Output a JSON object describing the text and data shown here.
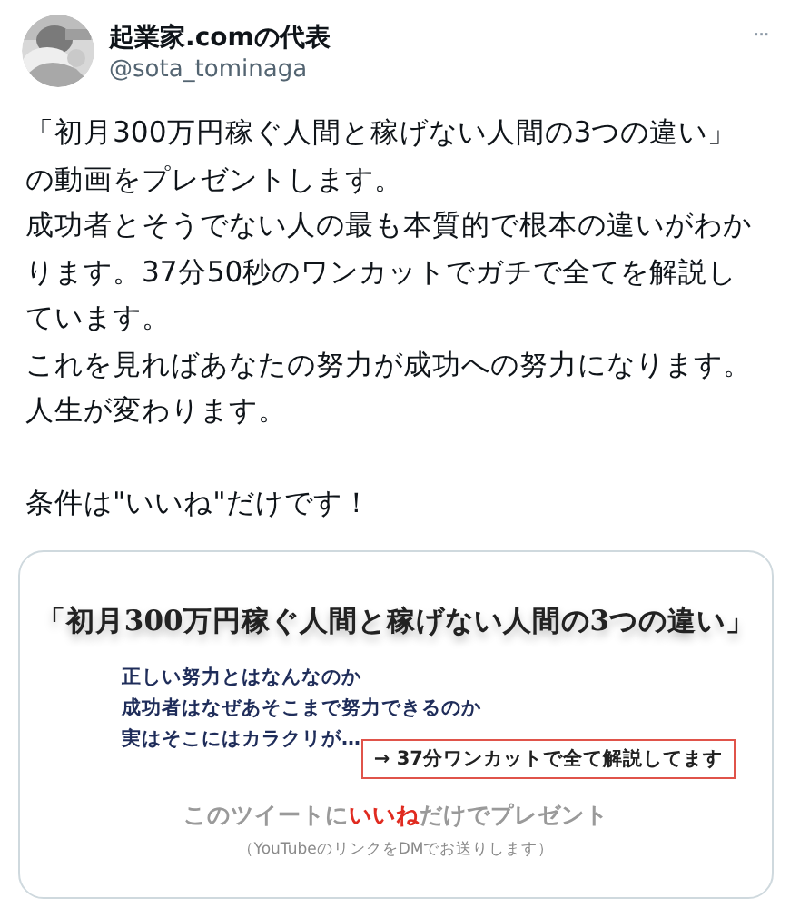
{
  "tweet": {
    "author": {
      "name": "起業家.comの代表",
      "handle": "@sota_tominaga"
    },
    "more_icon": "···",
    "body": [
      [
        "「初月300万円稼ぐ人間と稼げない人間の3つの違い」",
        "の動画をプレゼントします。",
        "成功者とそうでない人の最も本質的で根本の違いがわかります。37分50秒のワンカットでガチで全てを解説しています。",
        "これを見ればあなたの努力が成功への努力になります。人生が変わります。"
      ],
      [
        "条件は\"いいね\"だけです！"
      ]
    ],
    "image": {
      "title": "「初月300万円稼ぐ人間と稼げない人間の3つの違い」",
      "points": [
        "正しい努力とはなんなのか",
        "成功者はなぜあそこまで努力できるのか",
        "実はそこにはカラクリが…"
      ],
      "callout": "→ 37分ワンカットで全て解説してます",
      "cta": [
        {
          "text": "このツイートに",
          "emphasis": false
        },
        {
          "text": "いいね",
          "emphasis": true
        },
        {
          "text": "だけでプレゼント",
          "emphasis": false
        }
      ],
      "note": "（YouTubeのリンクをDMでお送りします）"
    }
  }
}
